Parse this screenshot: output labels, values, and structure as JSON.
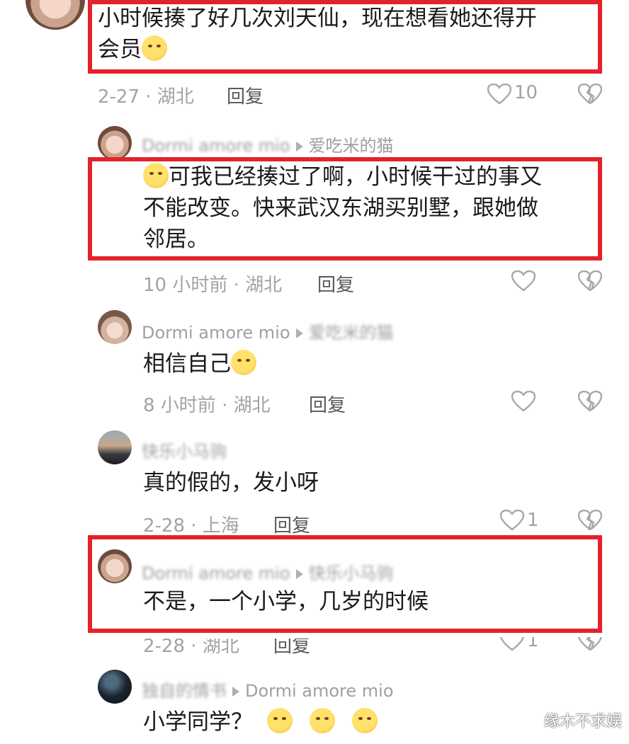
{
  "comments": [
    {
      "text_line1": "小时候揍了好几次刘天仙，现在想看她还得开",
      "text_line2": "会员",
      "meta": "2-27 · 湖北",
      "reply": "回复",
      "likes": "10"
    },
    {
      "user": "Dormi amore mio",
      "reply_to": "爱吃米的猫",
      "text_line1": "可我已经揍过了啊，小时候干过的事又",
      "text_line2": "不能改变。快来武汉东湖买别墅，跟她做",
      "text_line3": "邻居。",
      "meta": "10 小时前 · 湖北",
      "reply": "回复"
    },
    {
      "user": "Dormi amore mio",
      "reply_to": "爱吃米的猫",
      "text": "相信自己",
      "meta": "8 小时前 · 湖北",
      "reply": "回复"
    },
    {
      "user": "快乐小马驹",
      "text": "真的假的，发小呀",
      "meta": "2-28 · 上海",
      "reply": "回复",
      "likes": "1"
    },
    {
      "user": "Dormi amore mio",
      "reply_to": "快乐小马驹",
      "text": "不是，一个小学，几岁的时候",
      "meta": "2-28 · 湖北",
      "reply": "回复",
      "likes": "1"
    },
    {
      "user": "独自的情书",
      "reply_to": "Dormi amore mio",
      "text": "小学同学？"
    }
  ],
  "watermark": "缘木不求娱",
  "highlight_color": "#e5212b"
}
